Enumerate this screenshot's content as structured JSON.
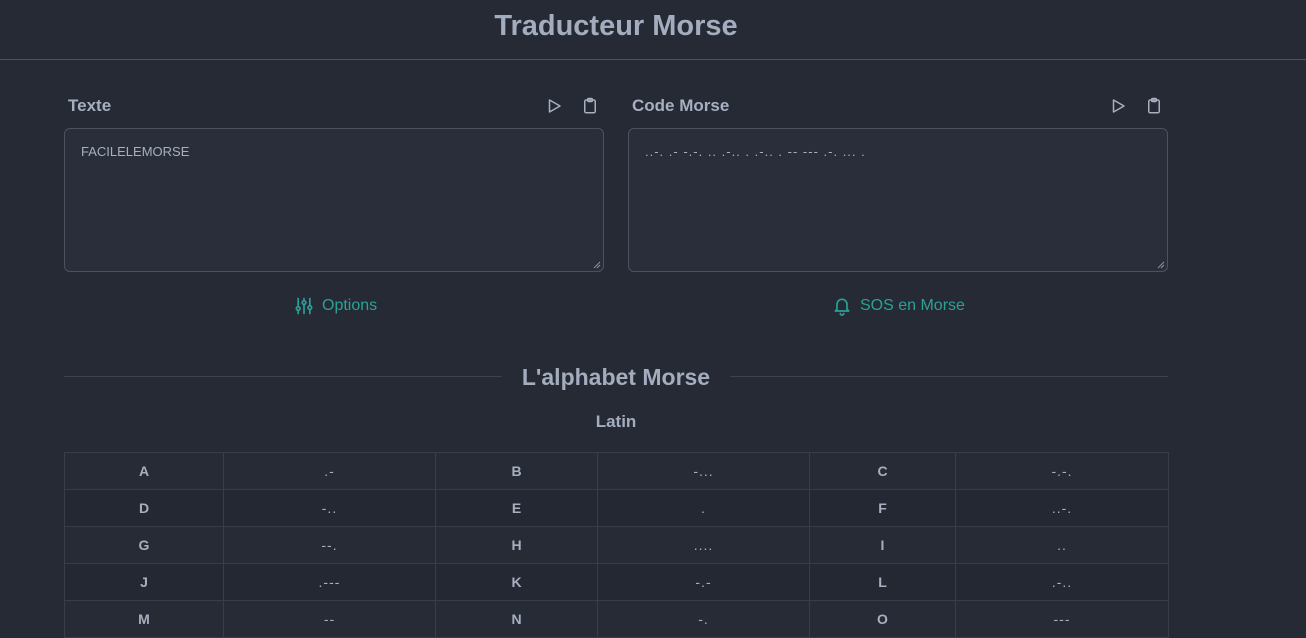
{
  "header": {
    "title": "Traducteur Morse"
  },
  "text_panel": {
    "title": "Texte",
    "value": "FACILELEMORSE",
    "play_icon": "play-icon",
    "copy_icon": "clipboard-icon"
  },
  "morse_panel": {
    "title": "Code Morse",
    "value": "..-. .- -.-. .. .-.. . .-.. . -- --- .-. ... .",
    "play_icon": "play-icon",
    "copy_icon": "clipboard-icon"
  },
  "links": {
    "options": "Options",
    "options_icon": "sliders-icon",
    "sos": "SOS en Morse",
    "sos_icon": "bell-icon"
  },
  "alphabet": {
    "title": "L'alphabet Morse",
    "subtitle": "Latin",
    "rows": [
      [
        [
          "A",
          ".-"
        ],
        [
          "B",
          "-..."
        ],
        [
          "C",
          "-.-."
        ]
      ],
      [
        [
          "D",
          "-.."
        ],
        [
          "E",
          "."
        ],
        [
          "F",
          "..-."
        ]
      ],
      [
        [
          "G",
          "--."
        ],
        [
          "H",
          "...."
        ],
        [
          "I",
          ".."
        ]
      ],
      [
        [
          "J",
          ".---"
        ],
        [
          "K",
          "-.-"
        ],
        [
          "L",
          ".-.."
        ]
      ],
      [
        [
          "M",
          "--"
        ],
        [
          "N",
          "-."
        ],
        [
          "O",
          "---"
        ]
      ]
    ]
  },
  "colors": {
    "background": "#252a35",
    "accent": "#2aa198",
    "text": "#a7b0c0",
    "border": "#4a5160"
  }
}
